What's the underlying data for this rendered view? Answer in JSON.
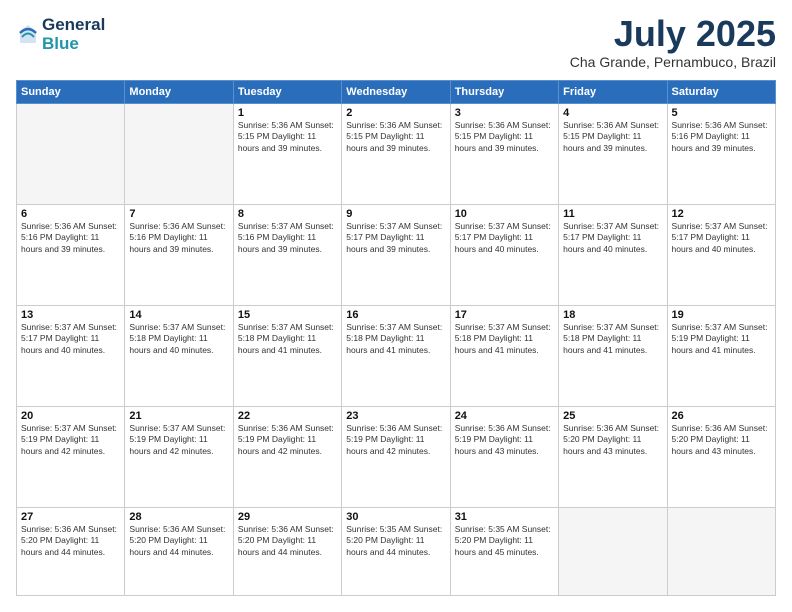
{
  "header": {
    "logo_line1": "General",
    "logo_line2": "Blue",
    "month": "July 2025",
    "location": "Cha Grande, Pernambuco, Brazil"
  },
  "weekdays": [
    "Sunday",
    "Monday",
    "Tuesday",
    "Wednesday",
    "Thursday",
    "Friday",
    "Saturday"
  ],
  "weeks": [
    [
      {
        "day": "",
        "info": ""
      },
      {
        "day": "",
        "info": ""
      },
      {
        "day": "1",
        "info": "Sunrise: 5:36 AM\nSunset: 5:15 PM\nDaylight: 11 hours\nand 39 minutes."
      },
      {
        "day": "2",
        "info": "Sunrise: 5:36 AM\nSunset: 5:15 PM\nDaylight: 11 hours\nand 39 minutes."
      },
      {
        "day": "3",
        "info": "Sunrise: 5:36 AM\nSunset: 5:15 PM\nDaylight: 11 hours\nand 39 minutes."
      },
      {
        "day": "4",
        "info": "Sunrise: 5:36 AM\nSunset: 5:15 PM\nDaylight: 11 hours\nand 39 minutes."
      },
      {
        "day": "5",
        "info": "Sunrise: 5:36 AM\nSunset: 5:16 PM\nDaylight: 11 hours\nand 39 minutes."
      }
    ],
    [
      {
        "day": "6",
        "info": "Sunrise: 5:36 AM\nSunset: 5:16 PM\nDaylight: 11 hours\nand 39 minutes."
      },
      {
        "day": "7",
        "info": "Sunrise: 5:36 AM\nSunset: 5:16 PM\nDaylight: 11 hours\nand 39 minutes."
      },
      {
        "day": "8",
        "info": "Sunrise: 5:37 AM\nSunset: 5:16 PM\nDaylight: 11 hours\nand 39 minutes."
      },
      {
        "day": "9",
        "info": "Sunrise: 5:37 AM\nSunset: 5:17 PM\nDaylight: 11 hours\nand 39 minutes."
      },
      {
        "day": "10",
        "info": "Sunrise: 5:37 AM\nSunset: 5:17 PM\nDaylight: 11 hours\nand 40 minutes."
      },
      {
        "day": "11",
        "info": "Sunrise: 5:37 AM\nSunset: 5:17 PM\nDaylight: 11 hours\nand 40 minutes."
      },
      {
        "day": "12",
        "info": "Sunrise: 5:37 AM\nSunset: 5:17 PM\nDaylight: 11 hours\nand 40 minutes."
      }
    ],
    [
      {
        "day": "13",
        "info": "Sunrise: 5:37 AM\nSunset: 5:17 PM\nDaylight: 11 hours\nand 40 minutes."
      },
      {
        "day": "14",
        "info": "Sunrise: 5:37 AM\nSunset: 5:18 PM\nDaylight: 11 hours\nand 40 minutes."
      },
      {
        "day": "15",
        "info": "Sunrise: 5:37 AM\nSunset: 5:18 PM\nDaylight: 11 hours\nand 41 minutes."
      },
      {
        "day": "16",
        "info": "Sunrise: 5:37 AM\nSunset: 5:18 PM\nDaylight: 11 hours\nand 41 minutes."
      },
      {
        "day": "17",
        "info": "Sunrise: 5:37 AM\nSunset: 5:18 PM\nDaylight: 11 hours\nand 41 minutes."
      },
      {
        "day": "18",
        "info": "Sunrise: 5:37 AM\nSunset: 5:18 PM\nDaylight: 11 hours\nand 41 minutes."
      },
      {
        "day": "19",
        "info": "Sunrise: 5:37 AM\nSunset: 5:19 PM\nDaylight: 11 hours\nand 41 minutes."
      }
    ],
    [
      {
        "day": "20",
        "info": "Sunrise: 5:37 AM\nSunset: 5:19 PM\nDaylight: 11 hours\nand 42 minutes."
      },
      {
        "day": "21",
        "info": "Sunrise: 5:37 AM\nSunset: 5:19 PM\nDaylight: 11 hours\nand 42 minutes."
      },
      {
        "day": "22",
        "info": "Sunrise: 5:36 AM\nSunset: 5:19 PM\nDaylight: 11 hours\nand 42 minutes."
      },
      {
        "day": "23",
        "info": "Sunrise: 5:36 AM\nSunset: 5:19 PM\nDaylight: 11 hours\nand 42 minutes."
      },
      {
        "day": "24",
        "info": "Sunrise: 5:36 AM\nSunset: 5:19 PM\nDaylight: 11 hours\nand 43 minutes."
      },
      {
        "day": "25",
        "info": "Sunrise: 5:36 AM\nSunset: 5:20 PM\nDaylight: 11 hours\nand 43 minutes."
      },
      {
        "day": "26",
        "info": "Sunrise: 5:36 AM\nSunset: 5:20 PM\nDaylight: 11 hours\nand 43 minutes."
      }
    ],
    [
      {
        "day": "27",
        "info": "Sunrise: 5:36 AM\nSunset: 5:20 PM\nDaylight: 11 hours\nand 44 minutes."
      },
      {
        "day": "28",
        "info": "Sunrise: 5:36 AM\nSunset: 5:20 PM\nDaylight: 11 hours\nand 44 minutes."
      },
      {
        "day": "29",
        "info": "Sunrise: 5:36 AM\nSunset: 5:20 PM\nDaylight: 11 hours\nand 44 minutes."
      },
      {
        "day": "30",
        "info": "Sunrise: 5:35 AM\nSunset: 5:20 PM\nDaylight: 11 hours\nand 44 minutes."
      },
      {
        "day": "31",
        "info": "Sunrise: 5:35 AM\nSunset: 5:20 PM\nDaylight: 11 hours\nand 45 minutes."
      },
      {
        "day": "",
        "info": ""
      },
      {
        "day": "",
        "info": ""
      }
    ]
  ]
}
